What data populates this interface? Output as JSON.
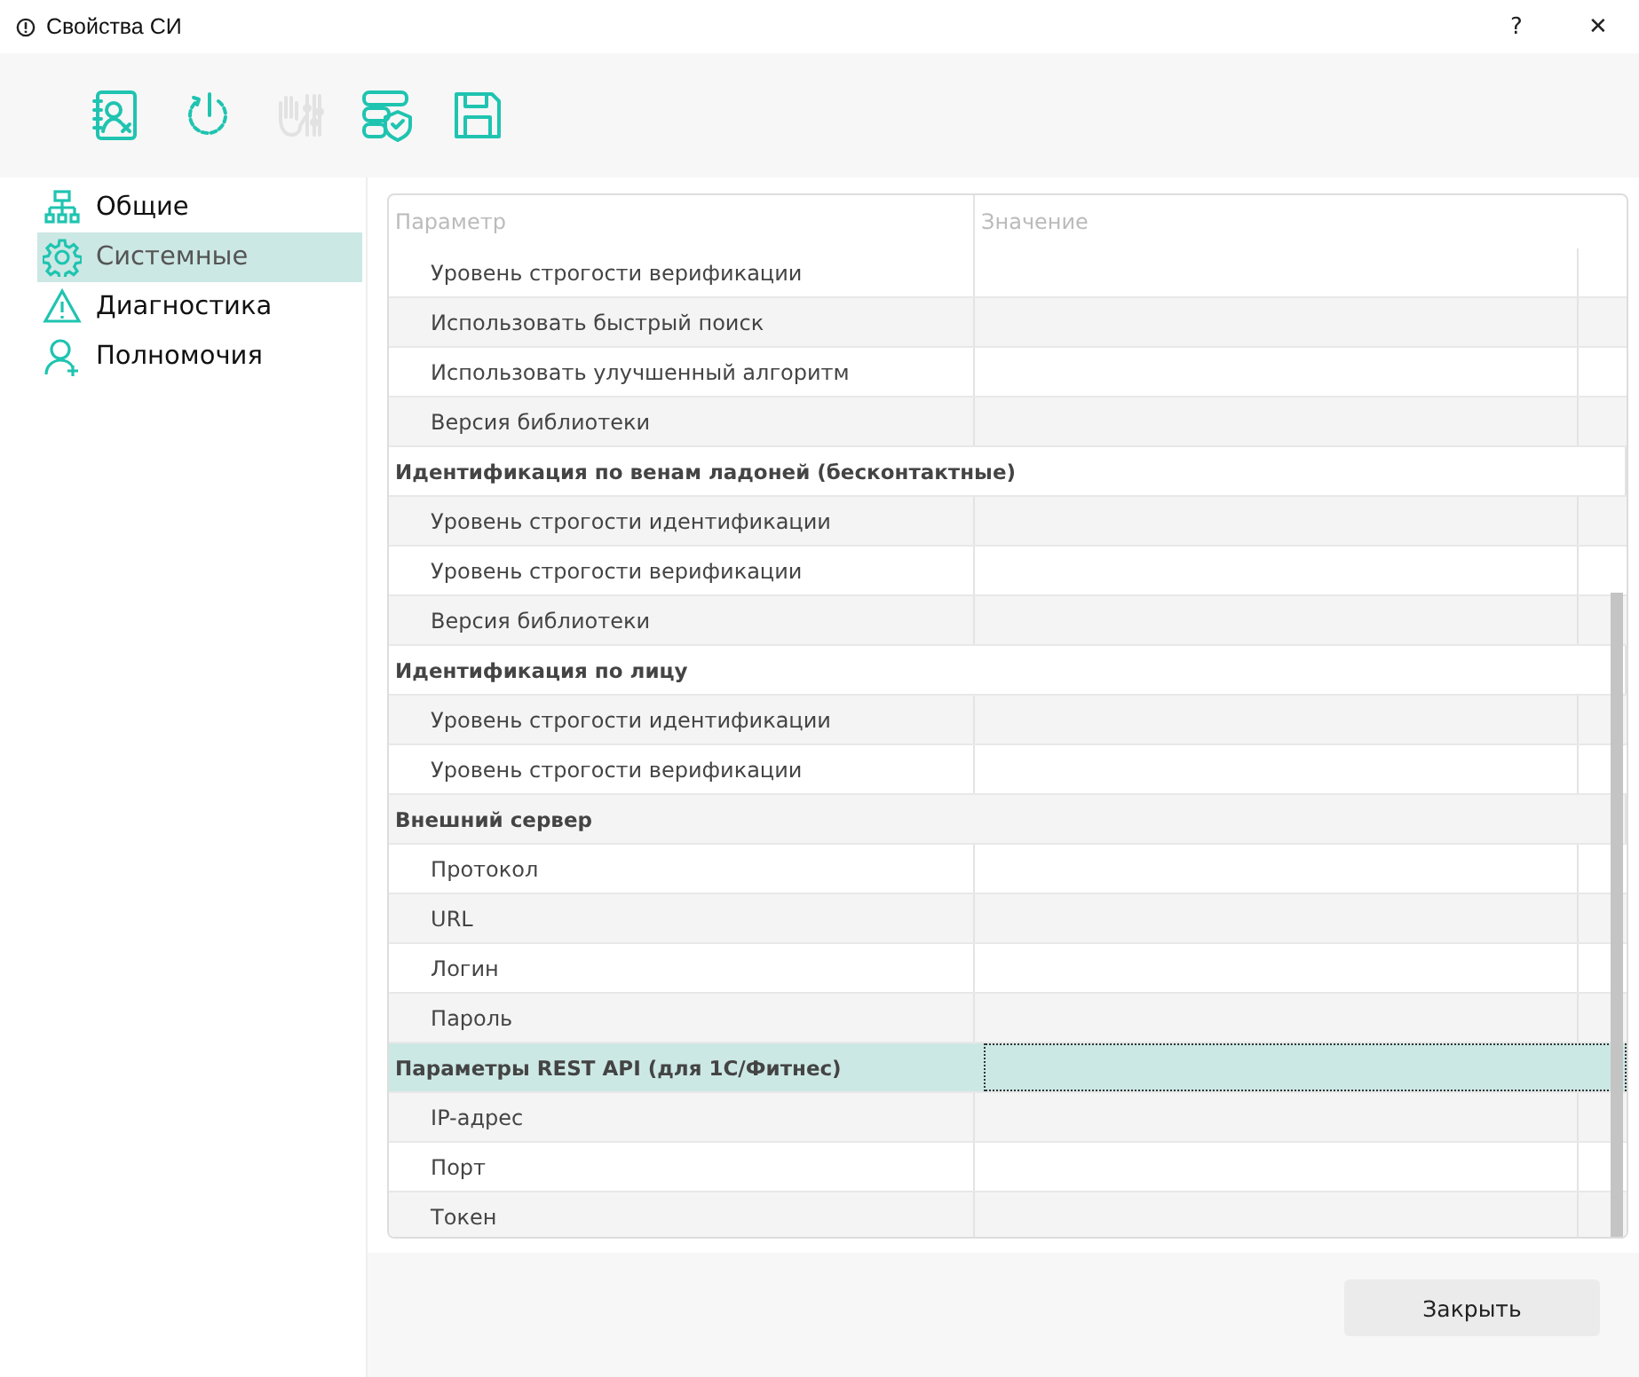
{
  "window": {
    "title": "Свойства СИ",
    "help": "?",
    "close": "✕"
  },
  "toolbar": [
    {
      "kind": "contact",
      "disabled": false
    },
    {
      "kind": "power",
      "disabled": false
    },
    {
      "kind": "palm",
      "disabled": true
    },
    {
      "kind": "server",
      "disabled": false
    },
    {
      "kind": "save",
      "disabled": false
    }
  ],
  "sidebar": {
    "items": [
      {
        "label": "Общие",
        "kind": "network",
        "selected": false
      },
      {
        "label": "Системные",
        "kind": "gear",
        "selected": true
      },
      {
        "label": "Диагностика",
        "kind": "warning",
        "selected": false
      },
      {
        "label": "Полномочия",
        "kind": "user",
        "selected": false
      }
    ]
  },
  "table": {
    "columns": [
      "Параметр",
      "Значение"
    ],
    "rows": [
      {
        "kind": "item",
        "label": "Уровень строгости верификации",
        "selected": false
      },
      {
        "kind": "item",
        "label": "Использовать быстрый поиск",
        "selected": false
      },
      {
        "kind": "item",
        "label": "Использовать улучшенный алгоритм",
        "selected": false
      },
      {
        "kind": "item",
        "label": "Версия библиотеки",
        "selected": false
      },
      {
        "kind": "group",
        "label": "Идентификация по венам ладоней (бесконтактные)",
        "selected": false
      },
      {
        "kind": "item",
        "label": "Уровень строгости идентификации",
        "selected": false
      },
      {
        "kind": "item",
        "label": "Уровень строгости верификации",
        "selected": false
      },
      {
        "kind": "item",
        "label": "Версия библиотеки",
        "selected": false
      },
      {
        "kind": "group",
        "label": "Идентификация по лицу",
        "selected": false
      },
      {
        "kind": "item",
        "label": "Уровень строгости идентификации",
        "selected": false
      },
      {
        "kind": "item",
        "label": "Уровень строгости верификации",
        "selected": false
      },
      {
        "kind": "group",
        "label": "Внешний сервер",
        "selected": false
      },
      {
        "kind": "item",
        "label": "Протокол",
        "selected": false
      },
      {
        "kind": "item",
        "label": "URL",
        "selected": false
      },
      {
        "kind": "item",
        "label": "Логин",
        "selected": false
      },
      {
        "kind": "item",
        "label": "Пароль",
        "selected": false
      },
      {
        "kind": "group",
        "label": "Параметры REST API (для 1С/Фитнес)",
        "selected": true
      },
      {
        "kind": "item",
        "label": "IP-адрес",
        "selected": false
      },
      {
        "kind": "item",
        "label": "Порт",
        "selected": false
      },
      {
        "kind": "item",
        "label": "Токен",
        "selected": false
      }
    ]
  },
  "buttons": [
    "Закрыть"
  ]
}
